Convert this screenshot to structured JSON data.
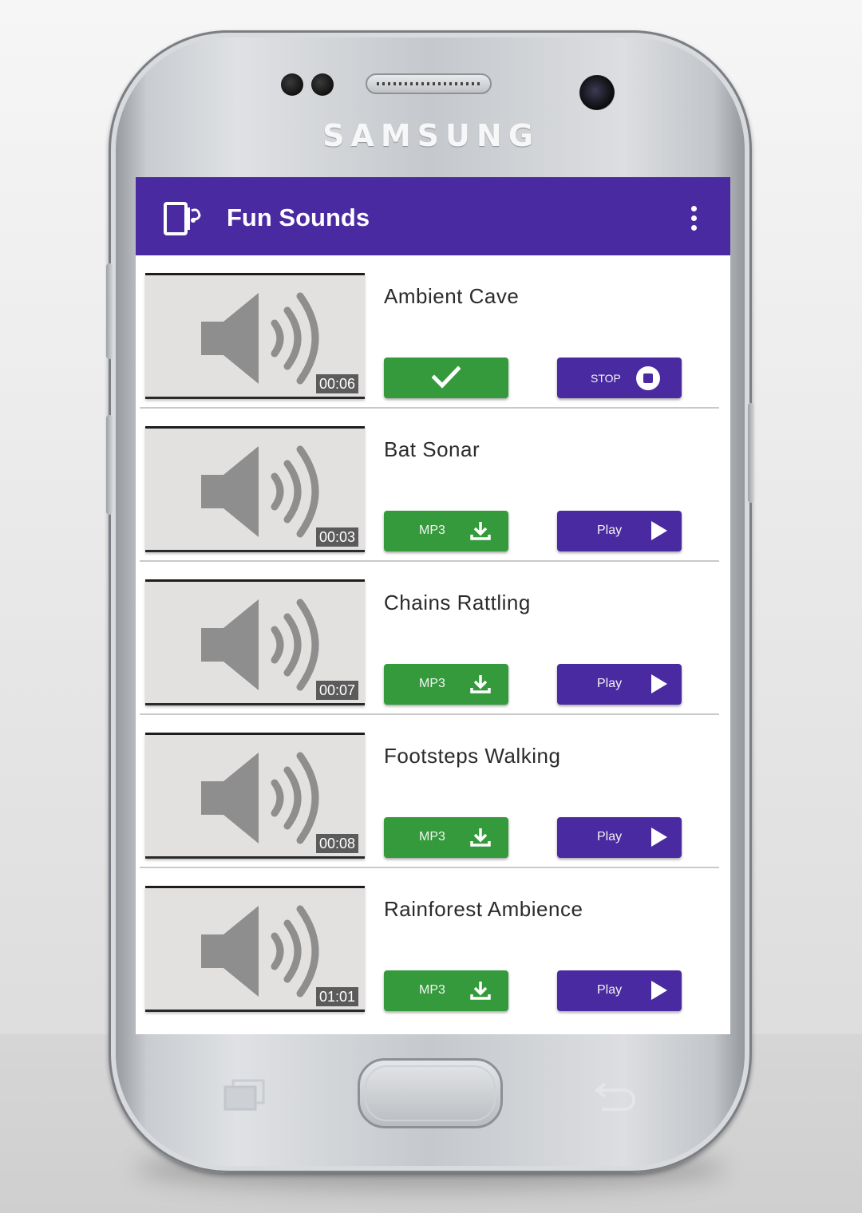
{
  "device": {
    "brand": "SAMSUNG"
  },
  "app": {
    "title": "Fun Sounds",
    "colors": {
      "appbar": "#4a2aa0",
      "download_button": "#359a3b",
      "play_button": "#4a2aa0"
    }
  },
  "sounds": [
    {
      "name": "Ambient Cave",
      "duration": "00:06",
      "left_button": {
        "state": "downloaded",
        "icon": "checkmark-icon"
      },
      "right_button": {
        "label": "STOP",
        "icon": "stop-icon"
      }
    },
    {
      "name": "Bat Sonar",
      "duration": "00:03",
      "left_button": {
        "label": "MP3",
        "icon": "download-icon"
      },
      "right_button": {
        "label": "Play",
        "icon": "play-icon"
      }
    },
    {
      "name": "Chains Rattling",
      "duration": "00:07",
      "left_button": {
        "label": "MP3",
        "icon": "download-icon"
      },
      "right_button": {
        "label": "Play",
        "icon": "play-icon"
      }
    },
    {
      "name": "Footsteps Walking",
      "duration": "00:08",
      "left_button": {
        "label": "MP3",
        "icon": "download-icon"
      },
      "right_button": {
        "label": "Play",
        "icon": "play-icon"
      }
    },
    {
      "name": "Rainforest Ambience",
      "duration": "01:01",
      "left_button": {
        "label": "MP3",
        "icon": "download-icon"
      },
      "right_button": {
        "label": "Play",
        "icon": "play-icon"
      }
    }
  ]
}
